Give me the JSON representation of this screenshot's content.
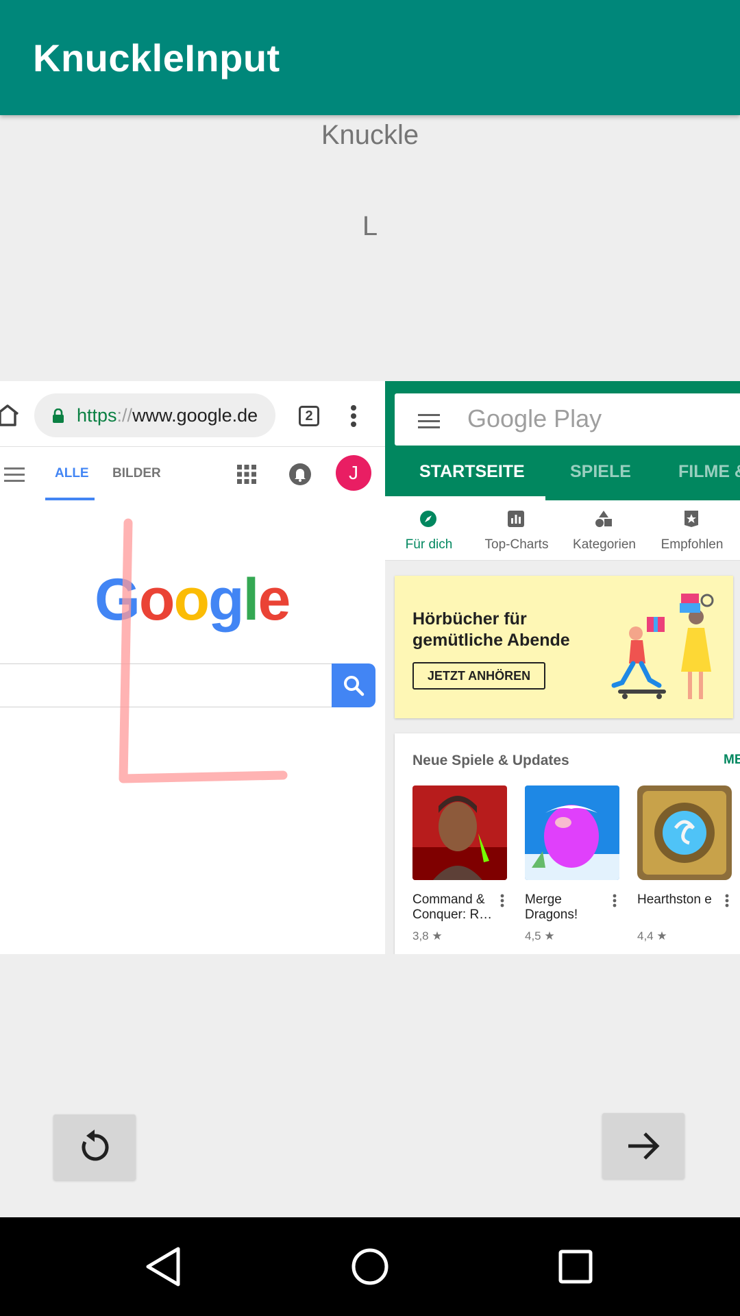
{
  "app": {
    "title": "KnuckleInput",
    "mode_label": "Knuckle",
    "gesture_letter": "L",
    "stroke_color": "#ff9a9a"
  },
  "chrome": {
    "url_scheme": "https",
    "url_sep": "://",
    "url_host": "www.google.de",
    "tab_count": "2",
    "tabs": [
      {
        "label": "ALLE",
        "active": true
      },
      {
        "label": "BILDER",
        "active": false
      }
    ],
    "avatar_letter": "J",
    "logo": [
      "G",
      "o",
      "o",
      "g",
      "l",
      "e"
    ]
  },
  "play": {
    "search_placeholder": "Google Play",
    "tabs": [
      "STARTSEITE",
      "SPIELE",
      "FILME &"
    ],
    "subnav": [
      "Für dich",
      "Top-Charts",
      "Kategorien",
      "Empfohlen"
    ],
    "promo": {
      "title": "Hörbücher für gemütliche Abende",
      "button": "JETZT ANHÖREN"
    },
    "games_section": {
      "title": "Neue Spiele & Updates",
      "more": "ME",
      "items": [
        {
          "name": "Command & Conquer: R…",
          "rating": "3,8 ★"
        },
        {
          "name": "Merge Dragons!",
          "rating": "4,5 ★"
        },
        {
          "name": "Hearthston e",
          "rating": "4,4 ★"
        }
      ]
    },
    "brand_color": "#01875f"
  },
  "icons": [
    "home-icon",
    "lock-icon",
    "kebab-icon",
    "menu-icon",
    "apps-icon",
    "bell-icon",
    "search-icon",
    "compass-icon",
    "chart-icon",
    "shapes-icon",
    "star-badge-icon",
    "reset-icon",
    "arrow-right-icon",
    "back-icon",
    "home-circle-icon",
    "recents-icon"
  ]
}
